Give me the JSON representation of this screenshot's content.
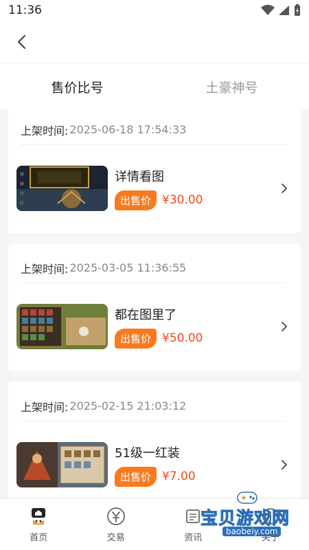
{
  "status_bar": {
    "time": "11:36"
  },
  "tabs": [
    {
      "label": "售价比号",
      "active": true
    },
    {
      "label": "土豪神号",
      "active": false
    }
  ],
  "listings": [
    {
      "time_label": "上架时间:",
      "time_value": "2025-06-18 17:54:33",
      "title": "详情看图",
      "badge": "出售价",
      "price": "¥30.00",
      "thumb": "game-screenshot-dark"
    },
    {
      "time_label": "上架时间:",
      "time_value": "2025-03-05 11:36:55",
      "title": "都在图里了",
      "badge": "出售价",
      "price": "¥50.00",
      "thumb": "game-screenshot-inventory"
    },
    {
      "time_label": "上架时间:",
      "time_value": "2025-02-15 21:03:12",
      "title": "51级一红装",
      "badge": "出售价",
      "price": "¥7.00",
      "thumb": "game-screenshot-character"
    }
  ],
  "tabbar": [
    {
      "label": "首页",
      "icon": "home-icon"
    },
    {
      "label": "交易",
      "icon": "exchange-icon"
    },
    {
      "label": "资讯",
      "icon": "news-icon"
    },
    {
      "label": "关于",
      "icon": "about-icon"
    }
  ],
  "watermark": {
    "main": "宝贝游戏网",
    "url": "baobeiy.com"
  },
  "colors": {
    "badge": "#f97a1e",
    "price": "#f04a1a",
    "accent_brand": "#f59a1b"
  }
}
